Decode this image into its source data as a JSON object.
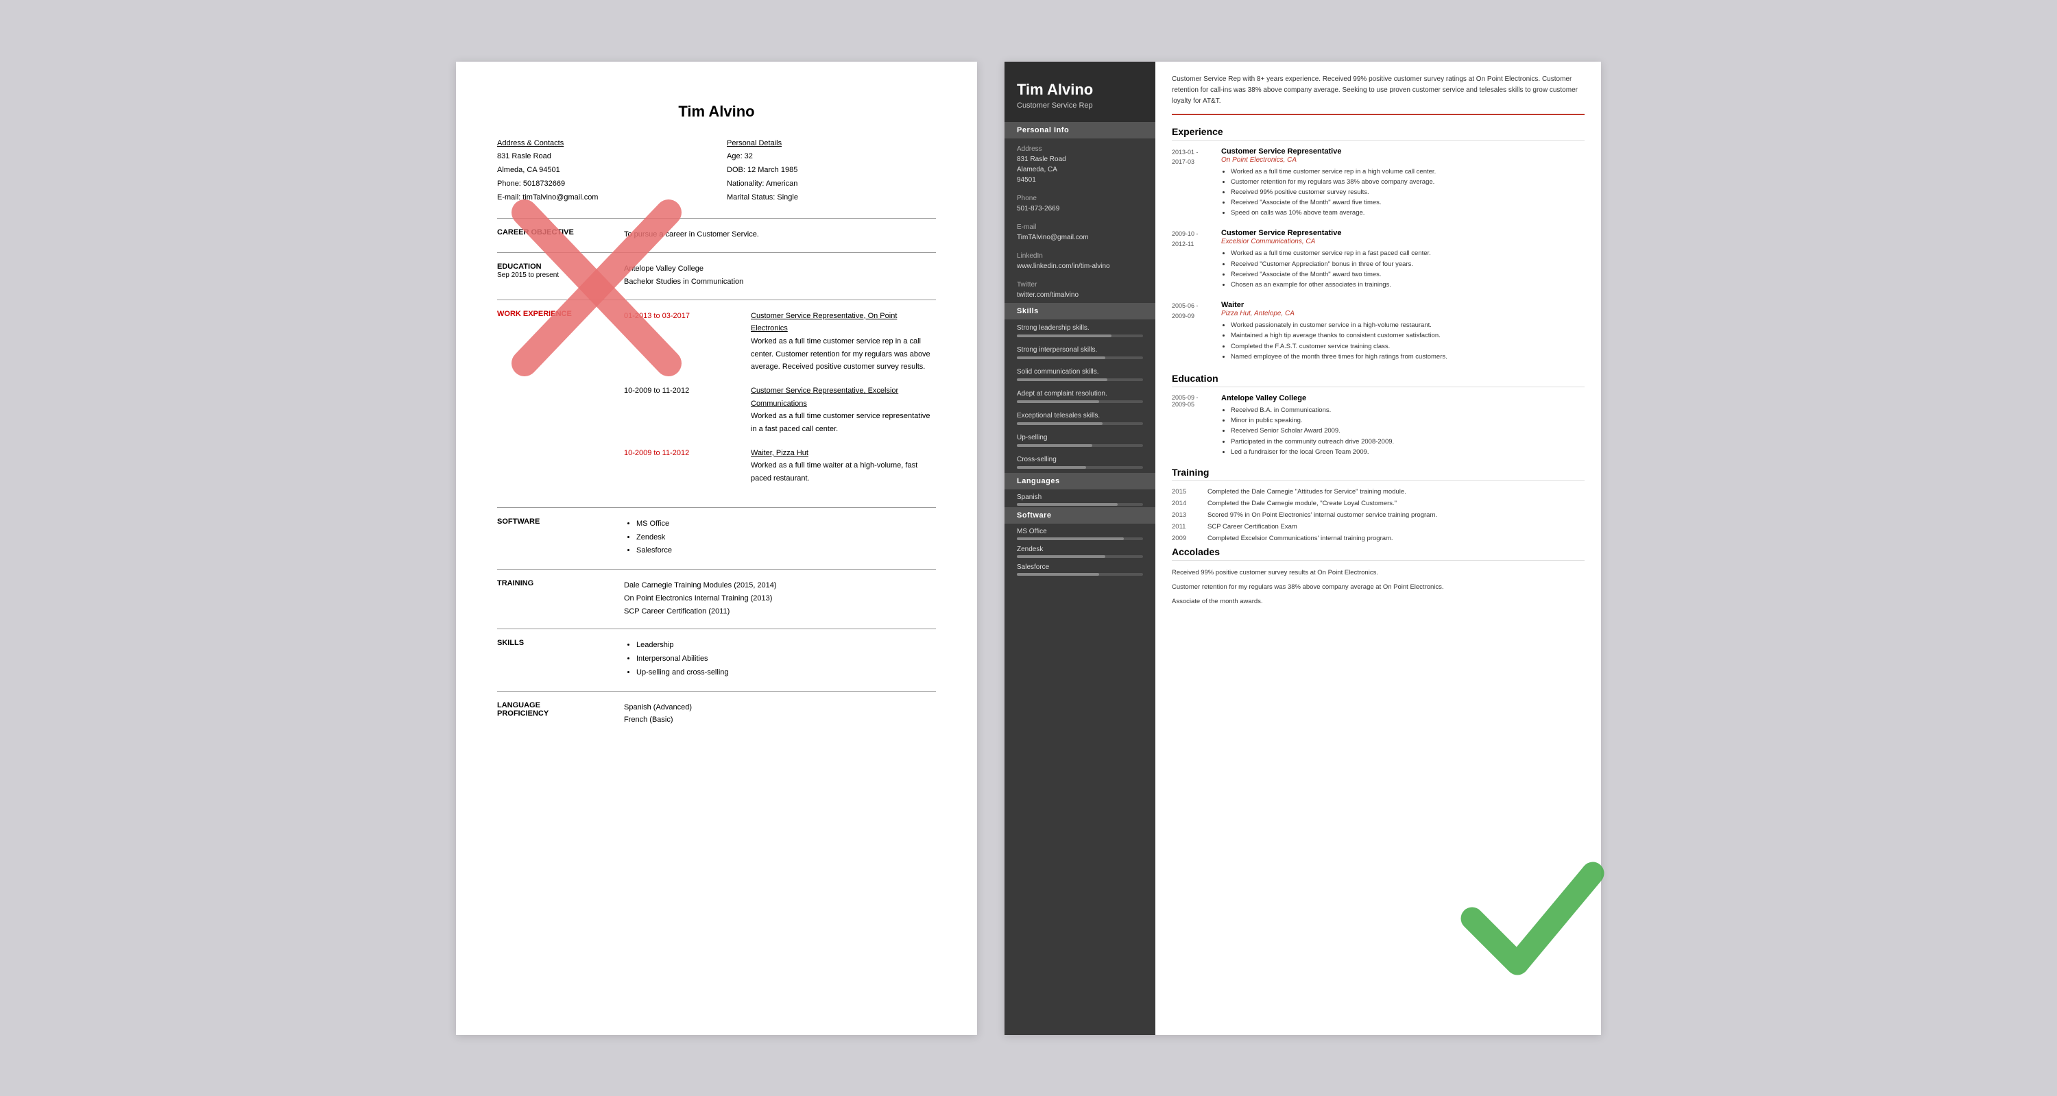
{
  "left_resume": {
    "name": "Tim Alvino",
    "address_label": "Address & Contacts",
    "address_lines": [
      "831 Rasle Road",
      "Almeda, CA 94501",
      "Phone: 5018732669",
      "E-mail: timTalvino@gmail.com"
    ],
    "personal_label": "Personal Details",
    "personal_lines": [
      "Age:   32",
      "DOB:  12 March 1985",
      "Nationality: American",
      "Marital Status: Single"
    ],
    "career_label": "CAREER OBJECTIVE",
    "career_text": "To pursue a career in Customer Service.",
    "education_label": "EDUCATION",
    "education_date": "Sep 2015 to present",
    "education_school": "Antelope Valley College",
    "education_degree": "Bachelor Studies in Communication",
    "work_label": "WORK EXPERIENCE",
    "work_entries": [
      {
        "date": "01-2013 to 03-2017",
        "title": "Customer Service Representative, On Point Electronics",
        "desc": "Worked as a full time customer service rep in a call center. Customer retention for my regulars was above average. Received positive customer survey results.",
        "date_red": true
      },
      {
        "date": "10-2009 to 11-2012",
        "title": "Customer Service Representative, Excelsior Communications",
        "desc": "Worked as a full time customer service representative in a fast paced call center.",
        "date_red": false
      },
      {
        "date": "10-2009 to 11-2012",
        "title": "Waiter, Pizza Hut",
        "desc": "Worked as a full time waiter at a high-volume, fast paced restaurant.",
        "date_red": true
      }
    ],
    "software_label": "SOFTWARE",
    "software_items": [
      "MS Office",
      "Zendesk",
      "Salesforce"
    ],
    "training_label": "TRAINING",
    "training_items": [
      "Dale Carnegie Training Modules (2015, 2014)",
      "On Point Electronics Internal Training (2013)",
      "SCP Career Certification (2011)"
    ],
    "skills_label": "SKILLS",
    "skills_items": [
      "Leadership",
      "Interpersonal Abilities",
      "Up-selling and cross-selling"
    ],
    "language_label": "LANGUAGE PROFICIENCY",
    "language_items": [
      "Spanish (Advanced)",
      "French (Basic)"
    ]
  },
  "right_resume": {
    "name": "Tim Alvino",
    "title": "Customer Service Rep",
    "summary": "Customer Service Rep with 8+ years experience. Received 99% positive customer survey ratings at On Point Electronics. Customer retention for call-ins was 38% above company average. Seeking to use proven customer service and telesales skills to grow customer loyalty for AT&T.",
    "sidebar": {
      "personal_info_label": "Personal Info",
      "address_label": "Address",
      "address_lines": [
        "831 Rasle Road",
        "Alameda, CA",
        "94501"
      ],
      "phone_label": "Phone",
      "phone": "501-873-2669",
      "email_label": "E-mail",
      "email": "TimTAlvino@gmail.com",
      "linkedin_label": "LinkedIn",
      "linkedin": "www.linkedin.com/in/tim-alvino",
      "twitter_label": "Twitter",
      "twitter": "twitter.com/timalvino",
      "skills_label": "Skills",
      "skills": [
        {
          "name": "Strong leadership skills.",
          "pct": 75
        },
        {
          "name": "Strong interpersonal skills.",
          "pct": 70
        },
        {
          "name": "Solid communication skills.",
          "pct": 72
        },
        {
          "name": "Adept at complaint resolution.",
          "pct": 65
        },
        {
          "name": "Exceptional telesales skills.",
          "pct": 68
        },
        {
          "name": "Up-selling",
          "pct": 60
        },
        {
          "name": "Cross-selling",
          "pct": 55
        }
      ],
      "languages_label": "Languages",
      "languages": [
        {
          "name": "Spanish",
          "pct": 80
        }
      ],
      "software_label": "Software",
      "software": [
        {
          "name": "MS Office",
          "pct": 85
        },
        {
          "name": "Zendesk",
          "pct": 70
        },
        {
          "name": "Salesforce",
          "pct": 65
        }
      ]
    },
    "experience_label": "Experience",
    "experiences": [
      {
        "start": "2013-01 -",
        "end": "2017-03",
        "title": "Customer Service Representative",
        "company": "On Point Electronics, CA",
        "bullets": [
          "Worked as a full time customer service rep in a high volume call center.",
          "Customer retention for my regulars was 38% above company average.",
          "Received 99% positive customer survey results.",
          "Received \"Associate of the Month\" award five times.",
          "Speed on calls was 10% above team average."
        ]
      },
      {
        "start": "2009-10 -",
        "end": "2012-11",
        "title": "Customer Service Representative",
        "company": "Excelsior Communications, CA",
        "bullets": [
          "Worked as a full time customer service rep in a fast paced call center.",
          "Received \"Customer Appreciation\" bonus in three of four years.",
          "Received \"Associate of the Month\" award two times.",
          "Chosen as an example for other associates in trainings."
        ]
      },
      {
        "start": "2005-06 -",
        "end": "2009-09",
        "title": "Waiter",
        "company": "Pizza Hut, Antelope, CA",
        "bullets": [
          "Worked passionately in customer service in a high-volume restaurant.",
          "Maintained a high tip average thanks to consistent customer satisfaction.",
          "Completed the F.A.S.T. customer service training class.",
          "Named employee of the month three times for high ratings from customers."
        ]
      }
    ],
    "education_label": "Education",
    "educations": [
      {
        "start": "2005-09 -",
        "end": "2009-05",
        "school": "Antelope Valley College",
        "bullets": [
          "Received B.A. in Communications.",
          "Minor in public speaking.",
          "Received Senior Scholar Award 2009.",
          "Participated in the community outreach drive 2008-2009.",
          "Led a fundraiser for the local Green Team 2009."
        ]
      }
    ],
    "training_label": "Training",
    "trainings": [
      {
        "year": "2015",
        "text": "Completed the Dale Carnegie \"Attitudes for Service\" training module."
      },
      {
        "year": "2014",
        "text": "Completed the Dale Carnegie module, \"Create Loyal Customers.\""
      },
      {
        "year": "2013",
        "text": "Scored 97% in On Point Electronics' internal customer service training program."
      },
      {
        "year": "2011",
        "text": "SCP Career Certification Exam"
      },
      {
        "year": "2009",
        "text": "Completed Excelsior Communications' internal training program."
      }
    ],
    "accolades_label": "Accolades",
    "accolades": [
      "Received 99% positive customer survey results at On Point Electronics.",
      "Customer retention for my regulars was 38% above company average at On Point Electronics.",
      "Associate of the month awards."
    ]
  }
}
